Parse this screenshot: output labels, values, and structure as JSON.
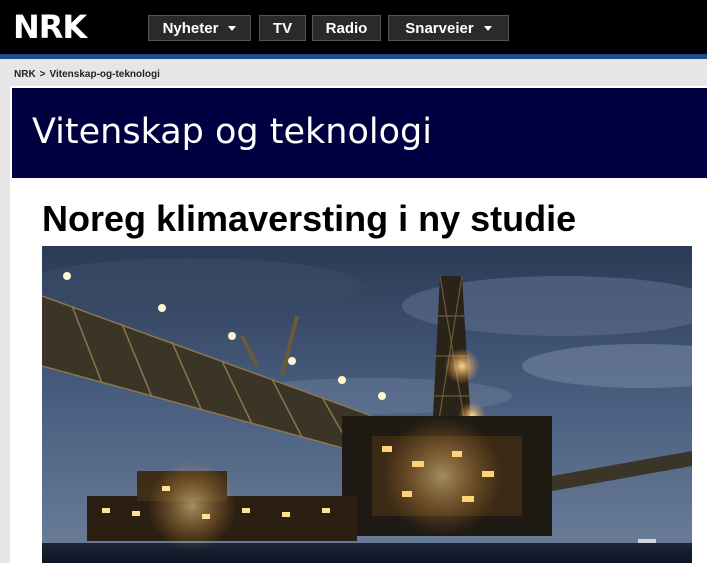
{
  "header": {
    "logo_text": "NRK",
    "nav": [
      {
        "label": "Nyheter",
        "has_dropdown": true
      },
      {
        "label": "TV",
        "has_dropdown": false
      },
      {
        "label": "Radio",
        "has_dropdown": false
      },
      {
        "label": "Snarveier",
        "has_dropdown": true
      }
    ],
    "colors": {
      "bar": "#000000",
      "accent_line": "#1a4f8b"
    }
  },
  "breadcrumb": {
    "root": "NRK",
    "separator": ">",
    "current": "Vitenskap-og-teknologi"
  },
  "section": {
    "title": "Vitenskap og teknologi",
    "color": "#000040"
  },
  "article": {
    "headline": "Noreg klimaversting i ny studie",
    "image_subject": "offshore oil platform at dusk"
  }
}
